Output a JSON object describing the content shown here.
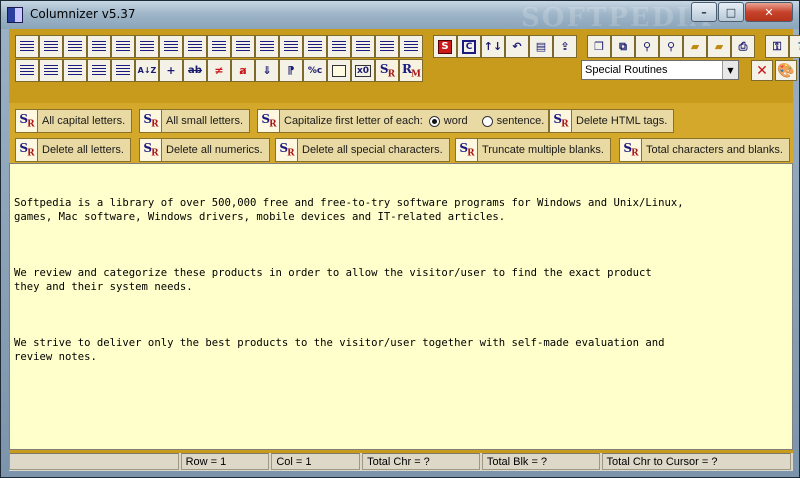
{
  "window": {
    "title": "Columnizer v5.37",
    "watermark": "SOFTPEDIA"
  },
  "toolbar": {
    "row1_icons": [
      "align-columns-icon",
      "column-left-icon",
      "column-shift-icon",
      "column-center-icon",
      "column-split-icon",
      "column-merge-icon",
      "indent-increase-icon",
      "indent-decrease-icon",
      "justify-icon",
      "justify-full-icon",
      "text-right-icon",
      "text-left-icon",
      "text-wrap-icon",
      "text-unwrap-icon",
      "insert-column-icon",
      "delete-column-icon",
      "text-format-icon",
      "search-icon",
      "copy-icon",
      "sort-icon",
      "undo-icon",
      "clipboard-paste-icon",
      "export-icon",
      "page-icon",
      "copy-doc-icon",
      "find-icon",
      "find-next-icon",
      "folder-open-icon",
      "folder-save-icon",
      "print-icon",
      "key-icon",
      "help-icon"
    ],
    "row1_special": {
      "s_label": "S",
      "c_label": "C"
    },
    "row2_labels": {
      "az": "A↓Z",
      "plus": "+",
      "abc": "ab",
      "x0": "x0",
      "pct": "%c"
    },
    "special_routines": {
      "selected": "Special Routines"
    }
  },
  "routines": {
    "all_capital": "All capital letters.",
    "all_small": "All small letters.",
    "capitalize": "Capitalize first letter of each:",
    "radio_word": "word",
    "radio_sentence": "sentence.",
    "delete_html": "Delete HTML tags.",
    "delete_letters": "Delete all letters.",
    "delete_numerics": "Delete all numerics.",
    "delete_special": "Delete all special characters.",
    "truncate_blanks": "Truncate multiple blanks.",
    "total_chars": "Total characters and blanks.",
    "sr_s": "S",
    "sr_r": "R"
  },
  "editor": {
    "paragraphs": [
      "Softpedia is a library of over 500,000 free and free-to-try software programs for Windows and Unix/Linux,\ngames, Mac software, Windows drivers, mobile devices and IT-related articles.",
      "We review and categorize these products in order to allow the visitor/user to find the exact product\nthey and their system needs.",
      "We strive to deliver only the best products to the visitor/user together with self-made evaluation and\nreview notes."
    ]
  },
  "statusbar": {
    "blank": "",
    "row": "Row = 1",
    "col": "Col = 1",
    "total_chr": "Total Chr = ?",
    "total_blk": "Total Blk = ?",
    "total_to_cursor": "Total Chr to Cursor = ?"
  },
  "colors": {
    "toolbar_bg": "#c89b1c",
    "routine_bg": "#d4a82a",
    "editor_bg": "#ffffcc",
    "accent_red": "#cc1a1a",
    "accent_blue": "#1a1a80"
  }
}
